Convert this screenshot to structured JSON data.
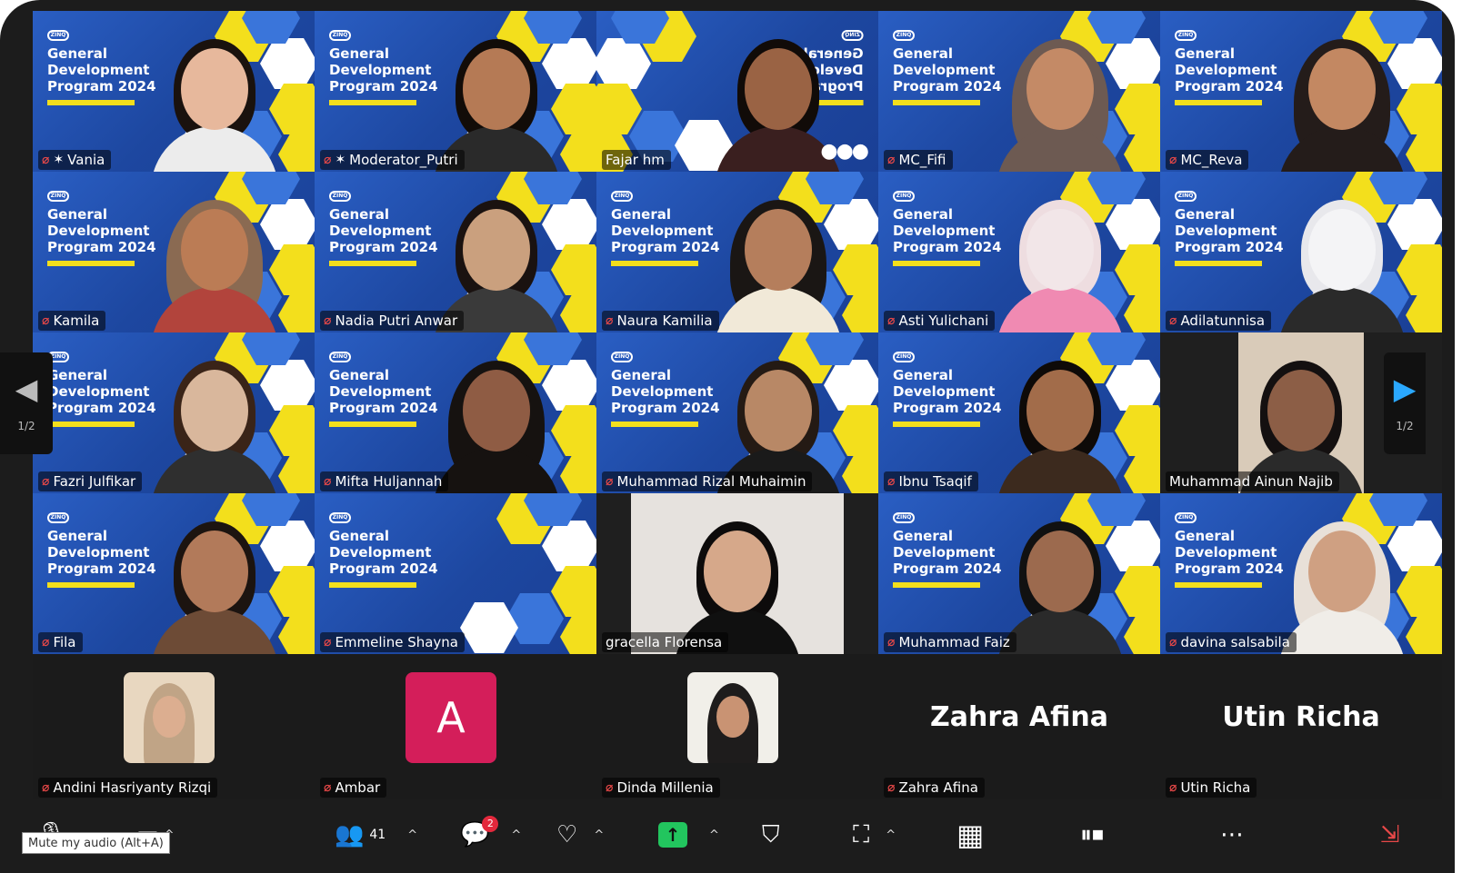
{
  "slide": {
    "lines": [
      "General",
      "Development",
      "Program 2024"
    ],
    "logo_text": "ZINQ"
  },
  "participants": [
    {
      "name": "Vania",
      "pinned": true,
      "skin": "#e7b89c",
      "hair": "#1a120e",
      "shirt": "#ececec",
      "hijab": false
    },
    {
      "name": "Moderator_Putri",
      "pinned": true,
      "skin": "#b57a55",
      "hair": "#120c08",
      "shirt": "#2a2a2a",
      "hijab": false
    },
    {
      "name": "Fajar hm",
      "active": true,
      "mirrored": true,
      "skin": "#9a6344",
      "hair": "#110b08",
      "shirt": "#3a1f1f",
      "hijab": false
    },
    {
      "name": "MC_Fifi",
      "skin": "#c48a66",
      "hair": "#6d5a52",
      "shirt": "#6d5a52",
      "hijab": true
    },
    {
      "name": "MC_Reva",
      "skin": "#c38862",
      "hair": "#241c1a",
      "shirt": "#241c1a",
      "hijab": true
    },
    {
      "name": "Kamila",
      "skin": "#bb7c55",
      "hair": "#8a6a52",
      "shirt": "#b2443c",
      "hijab": true
    },
    {
      "name": "Nadia Putri Anwar",
      "skin": "#caa07e",
      "hair": "#1a1210",
      "shirt": "#3a3a3a",
      "hijab": false
    },
    {
      "name": "Naura Kamilia",
      "skin": "#b57e5c",
      "hair": "#1a1614",
      "shirt": "#f1e9d8",
      "hijab": true
    },
    {
      "name": "Asti Yulichani",
      "skin": "#f2e6e8",
      "hair": "#eedde0",
      "shirt": "#f08ab2",
      "hijab": false
    },
    {
      "name": "Adilatunnisa",
      "skin": "#f4f4f6",
      "hair": "#e8e8ec",
      "shirt": "#2a2a2a",
      "hijab": false
    },
    {
      "name": "Fazri Julfikar",
      "skin": "#d9b79c",
      "hair": "#3a2418",
      "shirt": "#2f2f2f",
      "hijab": false
    },
    {
      "name": "Mifta Huljannah",
      "skin": "#8f5c44",
      "hair": "#161210",
      "shirt": "#161210",
      "hijab": true
    },
    {
      "name": "Muhammad Rizal Muhaimin",
      "skin": "#b88866",
      "hair": "#241a14",
      "shirt": "#1a1a1a",
      "hijab": false
    },
    {
      "name": "Ibnu Tsaqif",
      "skin": "#a26c4a",
      "hair": "#0e0a08",
      "shirt": "#3c2a1e",
      "hijab": false
    },
    {
      "name": "Muhammad Ainun Najib",
      "photo": true,
      "photo_bg": "#d9cbb9",
      "skin": "#8c5e46",
      "hair": "#141010",
      "shirt": "#2a2a2a",
      "hijab": false
    },
    {
      "name": "Fila",
      "skin": "#b27a5a",
      "hair": "#1c1410",
      "shirt": "#6d4b36",
      "hijab": false
    },
    {
      "name": "Emmeline Shayna",
      "skin": "#000000",
      "hair": "#000000",
      "shirt": "#000000",
      "hijab": false,
      "empty": true
    },
    {
      "name": "gracella Florensa",
      "photo": true,
      "photo_bg": "#e6e2de",
      "skin": "#d6a88a",
      "hair": "#0d0b0b",
      "shirt": "#101010",
      "hijab": false
    },
    {
      "name": "Muhammad Faiz",
      "skin": "#9c6a4e",
      "hair": "#111",
      "shirt": "#2a2a2a",
      "hijab": false
    },
    {
      "name": "davina salsabila",
      "skin": "#cfa082",
      "hair": "#e8e0d8",
      "shirt": "#f0ede8",
      "hijab": true
    }
  ],
  "strip": [
    {
      "name": "Andini Hasriyanty Rizqi",
      "kind": "photo",
      "photo_bg": "#e8d7c0",
      "skin": "#dcae90",
      "hair": "#c0a486"
    },
    {
      "name": "Ambar",
      "kind": "letter",
      "letter": "A"
    },
    {
      "name": "Dinda Millenia",
      "kind": "photo",
      "photo_bg": "#f1efe9",
      "skin": "#c99373",
      "hair": "#1e1c1c"
    },
    {
      "name": "Zahra Afina",
      "kind": "text",
      "display": "Zahra Afina"
    },
    {
      "name": "Utin Richa",
      "kind": "text",
      "display": "Utin Richa"
    }
  ],
  "pager": {
    "left": "1/2",
    "right": "1/2"
  },
  "toolbar": {
    "participants_count": "41",
    "chat_badge": "2",
    "tooltip": "Mute my audio (Alt+A)"
  },
  "colors": {
    "active_border": "#33d17a",
    "mic_off": "#e84848",
    "share": "#22c55e",
    "avatar_a": "#d41e5a"
  }
}
